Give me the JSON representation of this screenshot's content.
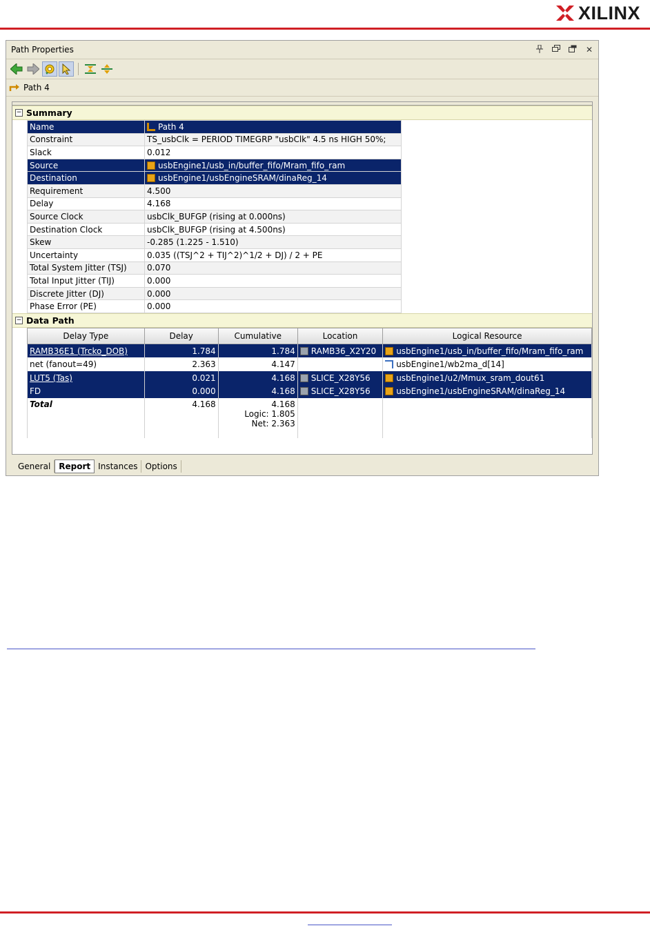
{
  "brand": {
    "name": "XILINX",
    "colors": {
      "rule": "#d01f25",
      "selection": "#0a246a"
    }
  },
  "panel": {
    "title": "Path Properties",
    "controls": [
      "pin-icon",
      "restore-icon",
      "float-icon",
      "close-icon"
    ],
    "close_glyph": "✕",
    "path_label": "Path 4"
  },
  "summary": {
    "heading": "Summary",
    "rows": [
      {
        "key": "Name",
        "value": "Path 4"
      },
      {
        "key": "Constraint",
        "value": "TS_usbClk = PERIOD TIMEGRP \"usbClk\" 4.5 ns HIGH 50%;"
      },
      {
        "key": "Slack",
        "value": "0.012"
      },
      {
        "key": "Source",
        "value": "usbEngine1/usb_in/buffer_fifo/Mram_fifo_ram"
      },
      {
        "key": "Destination",
        "value": "usbEngine1/usbEngineSRAM/dinaReg_14"
      },
      {
        "key": "Requirement",
        "value": "4.500"
      },
      {
        "key": "Delay",
        "value": "4.168"
      },
      {
        "key": "Source Clock",
        "value": "usbClk_BUFGP (rising at 0.000ns)"
      },
      {
        "key": "Destination Clock",
        "value": "usbClk_BUFGP (rising at 4.500ns)"
      },
      {
        "key": "Skew",
        "value": "-0.285 (1.225 - 1.510)"
      },
      {
        "key": "Uncertainty",
        "value": "0.035 ((TSJ^2 + TIJ^2)^1/2 + DJ) / 2 + PE"
      },
      {
        "key": "Total System Jitter (TSJ)",
        "value": "0.070"
      },
      {
        "key": "Total Input Jitter (TIJ)",
        "value": "0.000"
      },
      {
        "key": "Discrete Jitter (DJ)",
        "value": "0.000"
      },
      {
        "key": "Phase Error (PE)",
        "value": "0.000"
      }
    ]
  },
  "data_path": {
    "heading": "Data Path",
    "columns": [
      "Delay Type",
      "Delay",
      "Cumulative",
      "Location",
      "Logical Resource"
    ],
    "rows": [
      {
        "type": "RAMB36E1 (Trcko_DOB)",
        "delay": "1.784",
        "cumulative": "1.784",
        "location": "RAMB36_X2Y20",
        "resource": "usbEngine1/usb_in/buffer_fifo/Mram_fifo_ram"
      },
      {
        "type": "net (fanout=49)",
        "delay": "2.363",
        "cumulative": "4.147",
        "location": "",
        "resource": "usbEngine1/wb2ma_d[14]"
      },
      {
        "type": "LUT5 (Tas)",
        "delay": "0.021",
        "cumulative": "4.168",
        "location": "SLICE_X28Y56",
        "resource": "usbEngine1/u2/Mmux_sram_dout61"
      },
      {
        "type": "FD",
        "delay": "0.000",
        "cumulative": "4.168",
        "location": "SLICE_X28Y56",
        "resource": "usbEngine1/usbEngineSRAM/dinaReg_14"
      }
    ],
    "total": {
      "label": "Total",
      "delay": "4.168",
      "cumulative": "4.168",
      "logic": "Logic: 1.805",
      "net": "Net: 2.363"
    }
  },
  "tabs": [
    "General",
    "Report",
    "Instances",
    "Options"
  ]
}
